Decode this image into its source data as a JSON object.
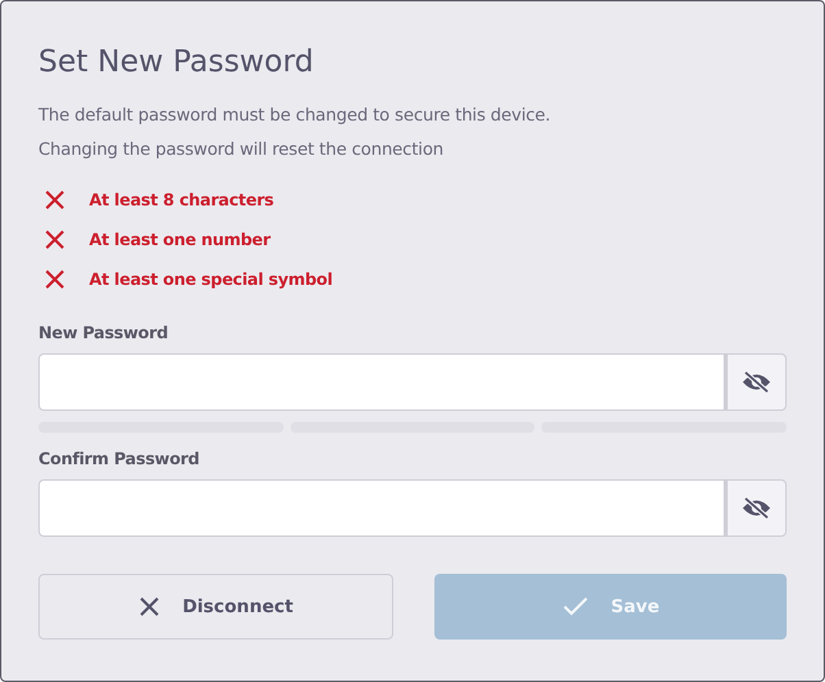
{
  "title": "Set New Password",
  "description": [
    "The default password must be changed to secure this device.",
    "Changing the password will reset the connection"
  ],
  "requirements": [
    {
      "label": "At least 8 characters",
      "met": false
    },
    {
      "label": "At least one number",
      "met": false
    },
    {
      "label": "At least one special symbol",
      "met": false
    }
  ],
  "fields": [
    {
      "label": "New Password",
      "visible": false,
      "strength_segments": [
        {
          "filled": false
        },
        {
          "filled": false
        },
        {
          "filled": false
        }
      ]
    },
    {
      "label": "Confirm Password",
      "visible": false
    }
  ],
  "buttons": [
    {
      "kind": "disconnect",
      "label": "Disconnect",
      "disabled": false
    },
    {
      "kind": "save",
      "label": "Save",
      "disabled": true
    }
  ]
}
